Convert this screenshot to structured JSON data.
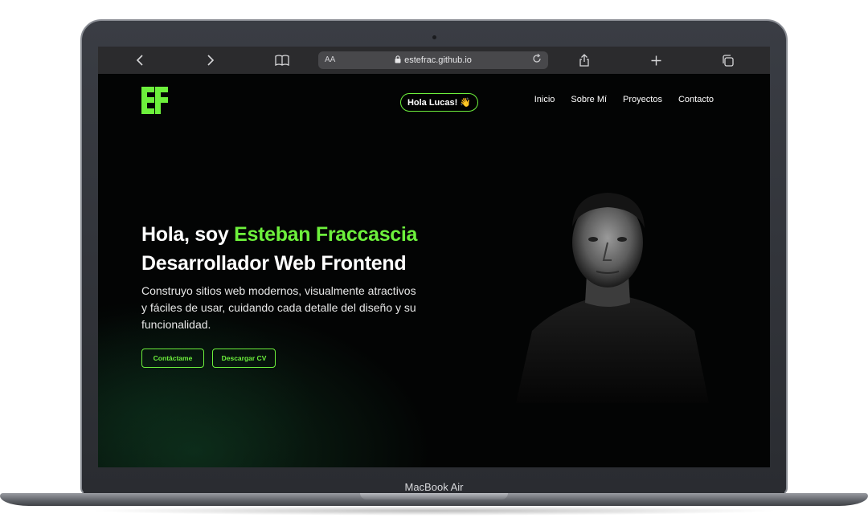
{
  "browser": {
    "address_text": "estefrac.github.io",
    "reader_label": "AA",
    "icons": {
      "back": "chevron-left-icon",
      "forward": "chevron-right-icon",
      "bookmarks": "book-icon",
      "lock": "lock-icon",
      "reload": "reload-icon",
      "share": "share-icon",
      "new_tab": "plus-icon",
      "tabs": "tabs-icon"
    }
  },
  "site": {
    "logo_alt": "EF",
    "greeting_pill": "Hola Lucas! 👋",
    "nav": [
      "Inicio",
      "Sobre Mí",
      "Proyectos",
      "Contacto"
    ],
    "hero": {
      "title_prefix": "Hola, soy ",
      "title_name": "Esteban Fraccascia",
      "title_line2": "Desarrollador Web Frontend",
      "description": "Construyo sitios web modernos, visualmente atractivos y fáciles de usar, cuidando cada detalle del diseño y su funcionalidad."
    },
    "buttons": {
      "contact": "Contáctame",
      "cv": "Descargar CV"
    }
  },
  "device": {
    "label": "MacBook Air"
  },
  "colors": {
    "accent": "#6df03c",
    "background": "#030404",
    "browser_bar": "#2b2b2d"
  }
}
